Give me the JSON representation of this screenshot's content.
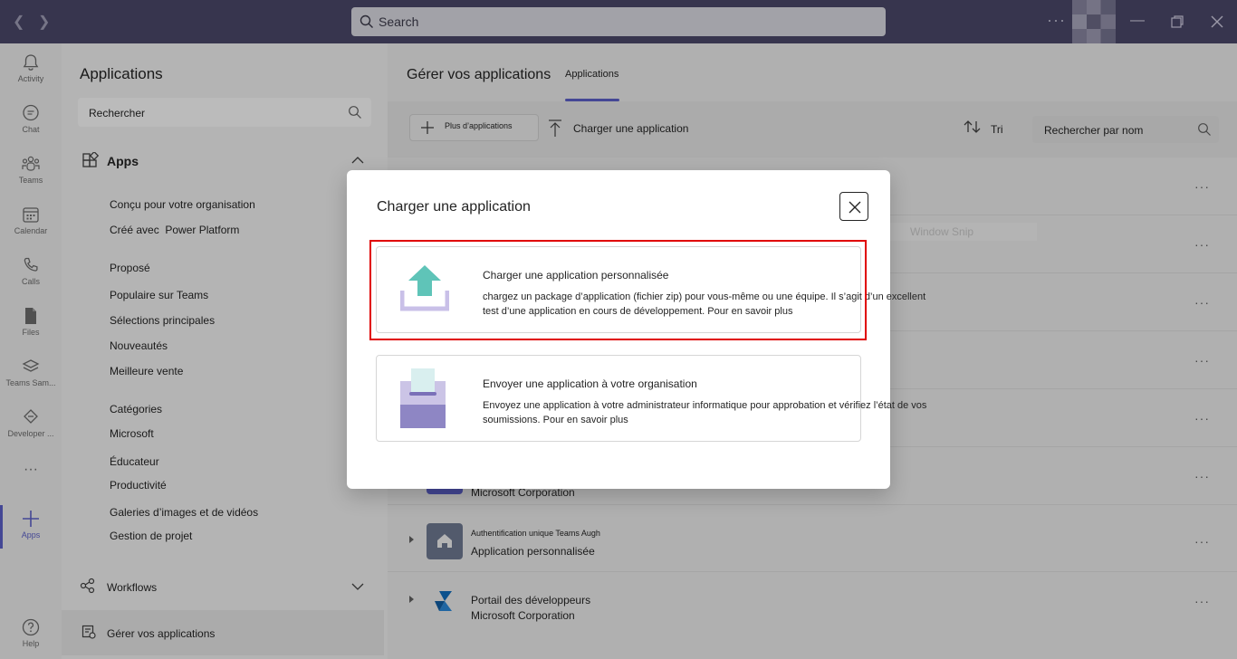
{
  "titlebar": {
    "search_placeholder": "Search",
    "more_label": "···"
  },
  "rail": {
    "items": [
      {
        "label": "Activity",
        "icon": "bell-icon"
      },
      {
        "label": "Chat",
        "icon": "chat-icon"
      },
      {
        "label": "Teams",
        "icon": "teams-icon"
      },
      {
        "label": "Calendar",
        "icon": "calendar-icon"
      },
      {
        "label": "Calls",
        "icon": "phone-icon"
      },
      {
        "label": "Files",
        "icon": "file-icon"
      },
      {
        "label": "Teams Sam...",
        "icon": "layers-icon"
      },
      {
        "label": "Developer ...",
        "icon": "developer-icon"
      },
      {
        "label": "Apps",
        "icon": "plus-icon"
      },
      {
        "label": "Help",
        "icon": "help-icon"
      }
    ],
    "more": "···"
  },
  "panel": {
    "title": "Applications",
    "search_placeholder": "Rechercher",
    "apps_header": "Apps",
    "items": [
      "Conçu pour votre organisation",
      "Créé avec  Power Platform",
      "Proposé",
      "Populaire sur Teams",
      "Sélections principales",
      "Nouveautés",
      "Meilleure vente",
      "Catégories",
      "Microsoft",
      "Éducateur",
      "Productivité",
      "Galeries d’images et de vidéos",
      "Gestion de projet"
    ],
    "workflows": "Workflows",
    "manage": "Gérer vos applications"
  },
  "main": {
    "title": "Gérer vos applications",
    "tab": "Applications",
    "more_apps": "Plus d’applications",
    "upload": "Charger une application",
    "sort": "Tri",
    "search_placeholder": "Rechercher par nom",
    "rows": [
      {
        "name": "",
        "sub": "Microsoft Corporation"
      },
      {
        "name": "Authentification unique Teams Augh",
        "sub": "Application personnalisée"
      },
      {
        "name": "Portail des développeurs",
        "sub": "Microsoft Corporation"
      }
    ],
    "ghost_text": "Window Snip"
  },
  "modal": {
    "title": "Charger une application",
    "options": [
      {
        "title": "Charger une application personnalisée",
        "desc_1": "chargez un package d’application (fichier zip) pour vous-même ou une équipe. Il s’agit d’un excellent",
        "desc_2": "test d’une application en cours de développement. Pour en savoir plus"
      },
      {
        "title": "Envoyer une application à votre organisation",
        "desc_1": "Envoyez une application à votre administrateur informatique pour approbation et vérifiez l’état de vos",
        "desc_2": "soumissions. Pour en savoir plus"
      }
    ]
  },
  "colors": {
    "titlebar": "#4a4768",
    "accent": "#5b5fc7",
    "highlight": "#e00000",
    "upload_icon": "#5fc4b8"
  }
}
